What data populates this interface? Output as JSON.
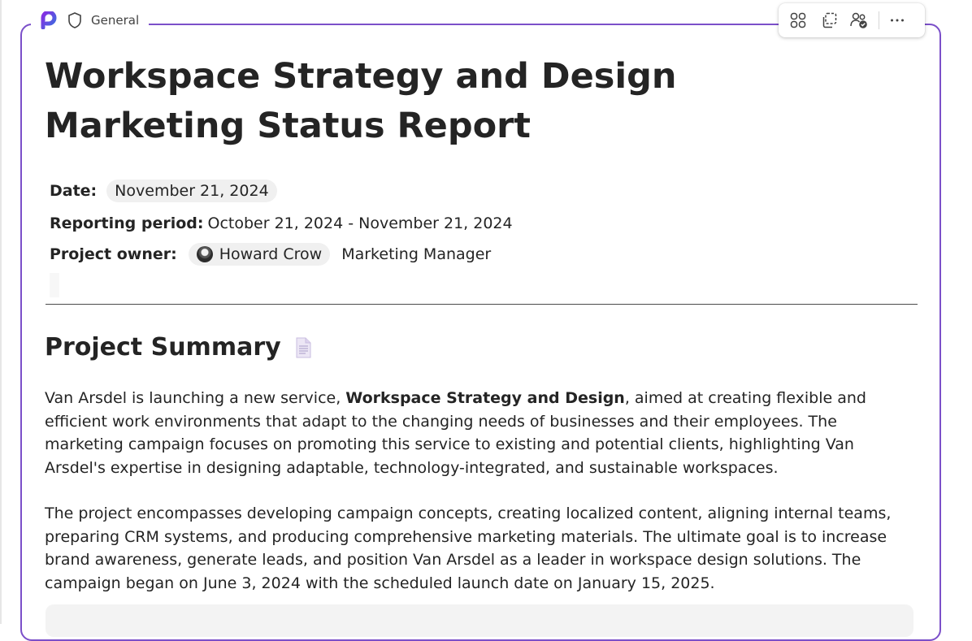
{
  "header": {
    "channel": "General"
  },
  "toolbar": {
    "buttons": [
      {
        "name": "components-icon"
      },
      {
        "name": "copy-component-icon"
      },
      {
        "name": "share-people-icon"
      },
      {
        "name": "more-options-icon"
      }
    ]
  },
  "document": {
    "title": "Workspace Strategy and Design Marketing Status Report",
    "date_label": "Date:",
    "date_value": "November 21, 2024",
    "period_label": "Reporting period:",
    "period_value": "October 21, 2024 - November 21, 2024",
    "owner_label": "Project owner:",
    "owner_name": "Howard Crow",
    "owner_role": "Marketing Manager",
    "summary_heading": "Project Summary",
    "para1_a": "Van Arsdel is launching a new service, ",
    "para1_bold": "Workspace Strategy and Design",
    "para1_b": ", aimed at creating flexible and efficient work environments that adapt to the changing needs of businesses and their employees. The marketing campaign focuses on promoting this service to existing and potential clients, highlighting Van Arsdel's expertise in designing adaptable, technology-integrated, and sustainable workspaces.",
    "para2": "The project encompasses developing campaign concepts, creating localized content, aligning internal teams, preparing CRM systems, and producing comprehensive marketing materials. The ultimate goal is to increase brand awareness, generate leads, and position Van Arsdel as a leader in workspace design solutions. The campaign began on June 3, 2024 with the scheduled launch date on January 15, 2025."
  },
  "colors": {
    "accent": "#7b4fc9",
    "text": "#242424",
    "pill": "#f0f0f0"
  }
}
